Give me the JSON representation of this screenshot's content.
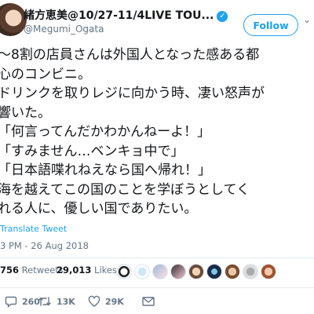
{
  "header": {
    "display_name": "緒方恵美@10/27-11/4LIVE TOU...",
    "verified_badge": "✓",
    "handle": "@Megumi_Ogata",
    "follow_label": "Follow",
    "more_icon": "chevron-down-icon"
  },
  "tweet": {
    "lines": [
      "〜8割の店員さんは外国人となった感ある都",
      "心のコンビニ。",
      "ドリンクを取りレジに向かう時、凄い怒声が",
      "響いた。",
      "「何言ってんだかわかんねーよ！」",
      "「すみません…ベンキョ中で」",
      "「日本語喋れねえなら国へ帰れ！」",
      "海を越えてこの国のことを学ぼうとしてく",
      "れる人に、優しい国でありたい。"
    ],
    "translate_label": "Translate Tweet",
    "timestamp": "3 PM - 26 Aug 2018"
  },
  "stats": {
    "retweets_count": "756",
    "retweets_label": "Retweets",
    "likes_count": "29,013",
    "likes_label": "Likes"
  },
  "actions": {
    "replies": "260",
    "retweets": "13K",
    "likes": "29K"
  },
  "colors": {
    "accent": "#1da1f2",
    "muted": "#657786",
    "text": "#14171a",
    "divider": "#e6ecf0"
  }
}
